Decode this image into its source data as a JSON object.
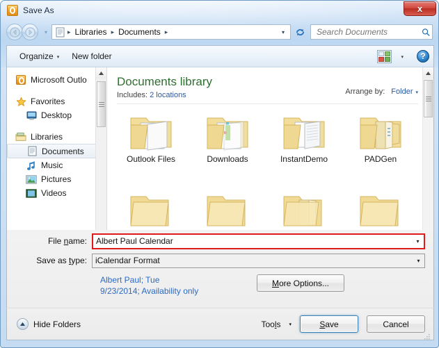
{
  "window": {
    "title": "Save As",
    "app_icon": "outlook-icon",
    "close_label": "x"
  },
  "navigation": {
    "back_tooltip": "Back",
    "forward_tooltip": "Forward",
    "recent_caret": "▾",
    "address_icon": "document-icon",
    "breadcrumbs": [
      "Libraries",
      "Documents"
    ],
    "breadcrumb_separator": "▸",
    "address_dropdown": "▾",
    "refresh_icon": "refresh-icon"
  },
  "search": {
    "placeholder": "Search Documents",
    "value": "",
    "icon": "magnifier-icon"
  },
  "toolbar": {
    "organize_label": "Organize",
    "organize_caret": "▾",
    "new_folder_label": "New folder",
    "view_icon": "view-mode-icon",
    "view_caret": "▾",
    "help_label": "?"
  },
  "sidebar": {
    "items": [
      {
        "label": "Microsoft Outlo",
        "icon": "outlook-icon",
        "indent": false,
        "selected": false,
        "gap_after": true
      },
      {
        "label": "Favorites",
        "icon": "star-icon",
        "indent": false,
        "selected": false,
        "gap_after": false
      },
      {
        "label": "Desktop",
        "icon": "desktop-icon",
        "indent": true,
        "selected": false,
        "gap_after": true
      },
      {
        "label": "Libraries",
        "icon": "libraries-icon",
        "indent": false,
        "selected": false,
        "gap_after": false
      },
      {
        "label": "Documents",
        "icon": "documents-icon",
        "indent": true,
        "selected": true,
        "gap_after": false
      },
      {
        "label": "Music",
        "icon": "music-icon",
        "indent": true,
        "selected": false,
        "gap_after": false
      },
      {
        "label": "Pictures",
        "icon": "pictures-icon",
        "indent": true,
        "selected": false,
        "gap_after": false
      },
      {
        "label": "Videos",
        "icon": "videos-icon",
        "indent": true,
        "selected": false,
        "gap_after": false
      }
    ]
  },
  "library": {
    "title": "Documents library",
    "includes_label": "Includes:",
    "includes_value": "2 locations",
    "arrange_label": "Arrange by:",
    "arrange_value": "Folder",
    "arrange_caret": "▾"
  },
  "files": [
    {
      "name": "Outlook Files",
      "icon": "folder-open-icon"
    },
    {
      "name": "Downloads",
      "icon": "folder-open-icon"
    },
    {
      "name": "InstantDemo",
      "icon": "folder-open-icon"
    },
    {
      "name": "PADGen",
      "icon": "folder-open-icon"
    },
    {
      "name": "",
      "icon": "folder-icon"
    },
    {
      "name": "",
      "icon": "folder-icon"
    },
    {
      "name": "",
      "icon": "folder-icon"
    },
    {
      "name": "",
      "icon": "folder-icon"
    }
  ],
  "form": {
    "file_name_label_pre": "File ",
    "file_name_label_key": "n",
    "file_name_label_post": "ame:",
    "file_name_value": "Albert Paul Calendar",
    "save_type_label_pre": "Save as ",
    "save_type_label_key": "t",
    "save_type_label_post": "ype:",
    "save_type_value": "iCalendar Format",
    "dropdown_caret": "▾",
    "info_text": "Albert Paul; Tue 9/23/2014; Availability only",
    "more_options_pre": "",
    "more_options_key": "M",
    "more_options_post": "ore Options..."
  },
  "footer": {
    "hide_folders_label": "Hide Folders",
    "hide_folders_icon": "chevron-up-circle-icon",
    "tools_label_pre": "Too",
    "tools_label_key": "l",
    "tools_label_post": "s",
    "tools_caret": "▾",
    "save_pre": "",
    "save_key": "S",
    "save_post": "ave",
    "cancel_label": "Cancel"
  },
  "colors": {
    "accent_blue": "#2659a4",
    "library_green": "#2f6e31",
    "highlight_red": "#e01a1a",
    "close_red": "#ba2d22",
    "folder_yellow": "#f5dd9a"
  }
}
